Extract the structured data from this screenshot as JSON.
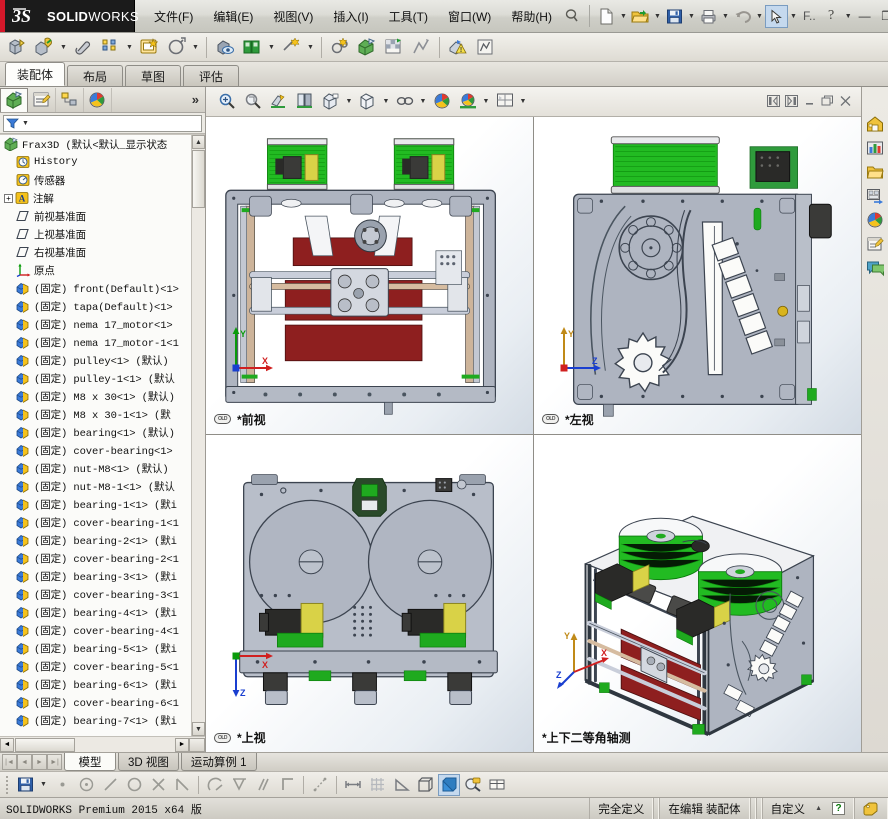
{
  "app": {
    "brand_ds": "3DS",
    "brand_name_bold": "SOLID",
    "brand_name_light": "WORKS"
  },
  "menu": {
    "items": [
      {
        "label": "文件(F)",
        "name": "menu-file"
      },
      {
        "label": "编辑(E)",
        "name": "menu-edit"
      },
      {
        "label": "视图(V)",
        "name": "menu-view"
      },
      {
        "label": "插入(I)",
        "name": "menu-insert"
      },
      {
        "label": "工具(T)",
        "name": "menu-tools"
      },
      {
        "label": "窗口(W)",
        "name": "menu-window"
      },
      {
        "label": "帮助(H)",
        "name": "menu-help"
      }
    ]
  },
  "quickaccess": {
    "search_label": "F..",
    "help_label": "?",
    "minimize": "—",
    "restore": "❐",
    "close": "✕"
  },
  "command_tabs": [
    {
      "label": "装配体",
      "name": "tab-assembly",
      "active": true
    },
    {
      "label": "布局",
      "name": "tab-layout",
      "active": false
    },
    {
      "label": "草图",
      "name": "tab-sketch",
      "active": false
    },
    {
      "label": "评估",
      "name": "tab-evaluate",
      "active": false
    }
  ],
  "feature_manager": {
    "more_label": "»",
    "root": "Frax3D    (默认<默认_显示状态",
    "items": [
      {
        "label": "History",
        "icon": "history-icon",
        "indent": 1,
        "expand": false
      },
      {
        "label": "传感器",
        "icon": "sensor-icon",
        "indent": 1,
        "expand": false
      },
      {
        "label": "注解",
        "icon": "annotation-icon",
        "indent": 1,
        "expand": true
      },
      {
        "label": "前视基准面",
        "icon": "plane-icon",
        "indent": 1,
        "expand": false
      },
      {
        "label": "上视基准面",
        "icon": "plane-icon",
        "indent": 1,
        "expand": false
      },
      {
        "label": "右视基准面",
        "icon": "plane-icon",
        "indent": 1,
        "expand": false
      },
      {
        "label": "原点",
        "icon": "origin-icon",
        "indent": 1,
        "expand": false
      },
      {
        "label": "(固定) front(Default)<1>",
        "icon": "part-icon",
        "indent": 1,
        "expand": false
      },
      {
        "label": "(固定) tapa(Default)<1>",
        "icon": "part-icon",
        "indent": 1,
        "expand": false
      },
      {
        "label": "(固定) nema 17_motor<1>",
        "icon": "part-icon",
        "indent": 1,
        "expand": false
      },
      {
        "label": "(固定) nema 17_motor-1<1",
        "icon": "part-icon",
        "indent": 1,
        "expand": false
      },
      {
        "label": "(固定) pulley<1> (默认)",
        "icon": "part-icon",
        "indent": 1,
        "expand": false
      },
      {
        "label": "(固定) pulley-1<1> (默认",
        "icon": "part-icon",
        "indent": 1,
        "expand": false
      },
      {
        "label": "(固定) M8 x 30<1> (默认)",
        "icon": "part-icon",
        "indent": 1,
        "expand": false
      },
      {
        "label": "(固定) M8 x 30-1<1> (默",
        "icon": "part-icon",
        "indent": 1,
        "expand": false
      },
      {
        "label": "(固定) bearing<1> (默认)",
        "icon": "part-icon",
        "indent": 1,
        "expand": false
      },
      {
        "label": "(固定) cover-bearing<1>",
        "icon": "part-icon",
        "indent": 1,
        "expand": false
      },
      {
        "label": "(固定) nut-M8<1> (默认)",
        "icon": "part-icon",
        "indent": 1,
        "expand": false
      },
      {
        "label": "(固定) nut-M8-1<1> (默认",
        "icon": "part-icon",
        "indent": 1,
        "expand": false
      },
      {
        "label": "(固定) bearing-1<1> (默i",
        "icon": "part-icon",
        "indent": 1,
        "expand": false
      },
      {
        "label": "(固定) cover-bearing-1<1",
        "icon": "part-icon",
        "indent": 1,
        "expand": false
      },
      {
        "label": "(固定) bearing-2<1> (默i",
        "icon": "part-icon",
        "indent": 1,
        "expand": false
      },
      {
        "label": "(固定) cover-bearing-2<1",
        "icon": "part-icon",
        "indent": 1,
        "expand": false
      },
      {
        "label": "(固定) bearing-3<1> (默i",
        "icon": "part-icon",
        "indent": 1,
        "expand": false
      },
      {
        "label": "(固定) cover-bearing-3<1",
        "icon": "part-icon",
        "indent": 1,
        "expand": false
      },
      {
        "label": "(固定) bearing-4<1> (默i",
        "icon": "part-icon",
        "indent": 1,
        "expand": false
      },
      {
        "label": "(固定) cover-bearing-4<1",
        "icon": "part-icon",
        "indent": 1,
        "expand": false
      },
      {
        "label": "(固定) bearing-5<1> (默i",
        "icon": "part-icon",
        "indent": 1,
        "expand": false
      },
      {
        "label": "(固定) cover-bearing-5<1",
        "icon": "part-icon",
        "indent": 1,
        "expand": false
      },
      {
        "label": "(固定) bearing-6<1> (默i",
        "icon": "part-icon",
        "indent": 1,
        "expand": false
      },
      {
        "label": "(固定) cover-bearing-6<1",
        "icon": "part-icon",
        "indent": 1,
        "expand": false
      },
      {
        "label": "(固定) bearing-7<1> (默i",
        "icon": "part-icon",
        "indent": 1,
        "expand": false
      }
    ]
  },
  "viewports": [
    {
      "name": "viewport-front",
      "label": "前视",
      "prefix": "*",
      "locked": true
    },
    {
      "name": "viewport-left",
      "label": "左视",
      "prefix": "*",
      "locked": true
    },
    {
      "name": "viewport-top",
      "label": "上视",
      "prefix": "*",
      "locked": true
    },
    {
      "name": "viewport-iso",
      "label": "上下二等角轴测",
      "prefix": "*",
      "locked": false
    }
  ],
  "triads": {
    "front": {
      "x": "X",
      "y": "Y"
    },
    "left": {
      "z": "Z",
      "y": "Y"
    },
    "top": {
      "x": "X",
      "z": "Z"
    },
    "iso": {
      "x": "X",
      "y": "Y",
      "z": "Z"
    }
  },
  "document_tabs": [
    {
      "label": "模型",
      "name": "doctab-model",
      "active": true
    },
    {
      "label": "3D 视图",
      "name": "doctab-3dviews",
      "active": false
    },
    {
      "label": "运动算例 1",
      "name": "doctab-motion-study",
      "active": false
    }
  ],
  "statusbar": {
    "product": "SOLIDWORKS Premium 2015 x64 版",
    "state": "完全定义",
    "editing": "在编辑 装配体",
    "custom": "自定义",
    "help_badge": "?"
  },
  "colors": {
    "brand_red": "#d4182a",
    "brand_black": "#1b1b1b",
    "accent_blue": "#3b6ea5",
    "model_gray": "#aab0bc",
    "model_red": "#8e1f1f",
    "filament_green": "#22bb22",
    "selection_blue": "#c5d9ee"
  }
}
